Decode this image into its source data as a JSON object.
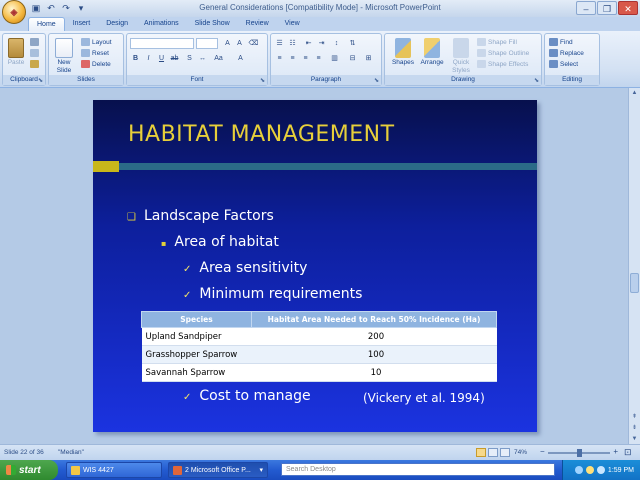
{
  "window": {
    "title": "General Considerations [Compatibility Mode] - Microsoft PowerPoint"
  },
  "ribbon": {
    "tabs": [
      "Home",
      "Insert",
      "Design",
      "Animations",
      "Slide Show",
      "Review",
      "View"
    ],
    "clipboard": {
      "paste": "Paste",
      "label": "Clipboard"
    },
    "slides": {
      "new_slide": "New Slide",
      "layout": "Layout",
      "reset": "Reset",
      "delete": "Delete",
      "label": "Slides"
    },
    "font": {
      "label": "Font"
    },
    "paragraph": {
      "label": "Paragraph"
    },
    "drawing": {
      "shapes": "Shapes",
      "arrange": "Arrange",
      "quick_styles": "Quick Styles",
      "shape_fill": "Shape Fill",
      "shape_outline": "Shape Outline",
      "shape_effects": "Shape Effects",
      "label": "Drawing"
    },
    "editing": {
      "find": "Find",
      "replace": "Replace",
      "select": "Select",
      "label": "Editing"
    }
  },
  "slide": {
    "title": "HABITAT MANAGEMENT",
    "bullets": [
      {
        "text": "Landscape Factors",
        "level": 1
      },
      {
        "text": "Area of habitat",
        "level": 2
      },
      {
        "text": "Area sensitivity",
        "level": 3
      },
      {
        "text": "Minimum requirements",
        "level": 3
      },
      {
        "text": "Cost to manage",
        "level": 3
      }
    ],
    "table": {
      "headers": [
        "Species",
        "Habitat Area Needed to Reach 50% Incidence (Ha)"
      ],
      "rows": [
        [
          "Upland Sandpiper",
          "200"
        ],
        [
          "Grasshopper Sparrow",
          "100"
        ],
        [
          "Savannah Sparrow",
          "10"
        ]
      ]
    },
    "citation": "(Vickery et al. 1994)",
    "colors": {
      "title": "#e7cf3a",
      "accent_bar": "#c8b71a",
      "background_top": "#07104d",
      "background_bottom": "#1b33e0"
    }
  },
  "status": {
    "slide_info": "Slide 22 of 36",
    "theme": "\"Median\"",
    "zoom": "74%",
    "zoom_fraction": 0.5
  },
  "taskbar": {
    "start": "start",
    "tasks": [
      "WIS 4427",
      "2 Microsoft Office P..."
    ],
    "search_placeholder": "Search Desktop",
    "clock": "1:59 PM"
  }
}
